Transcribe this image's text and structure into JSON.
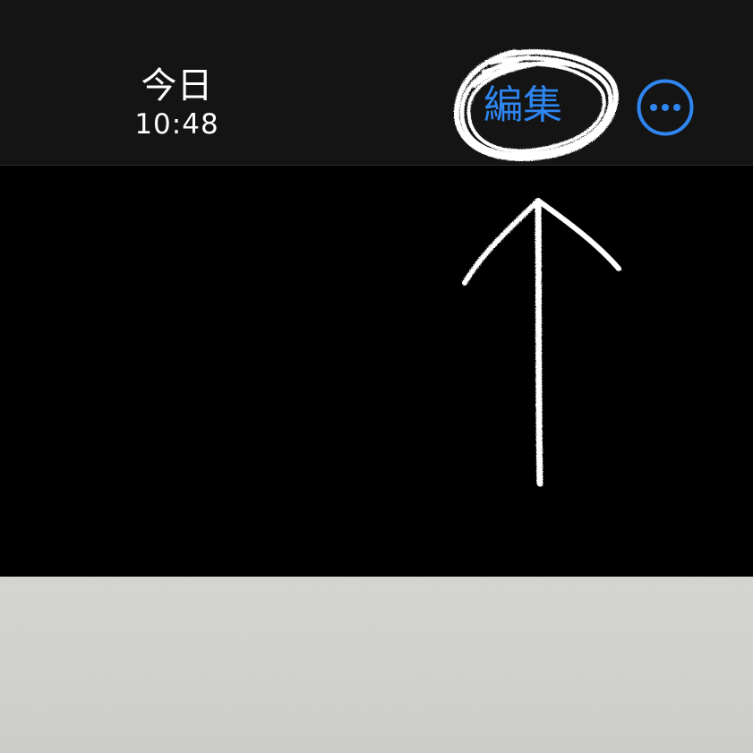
{
  "navbar": {
    "title_date": "今日",
    "title_time": "10:48",
    "edit_label": "編集",
    "more_icon": "ellipsis-circle-icon"
  },
  "colors": {
    "accent": "#2f86f0",
    "navbar_bg": "#141414",
    "content_bg": "#000000",
    "annotation": "#ffffff",
    "paper": "#d4d4d2"
  },
  "annotations": {
    "circle_target": "edit-button",
    "arrow_direction": "up"
  }
}
